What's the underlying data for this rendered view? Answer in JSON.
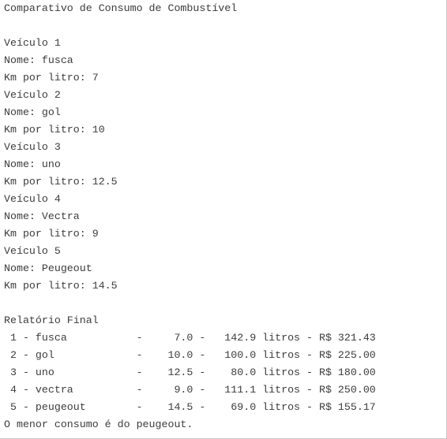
{
  "console": {
    "lines": [
      "Comparativo de Consumo de Combustível",
      "",
      "Veículo 1",
      "Nome: fusca",
      "Km por litro: 7",
      "Veículo 2",
      "Nome: gol",
      "Km por litro: 10",
      "Veículo 3",
      "Nome: uno",
      "Km por litro: 12.5",
      "Veículo 4",
      "Nome: Vectra",
      "Km por litro: 9",
      "Veículo 5",
      "Nome: Peugeout",
      "Km por litro: 14.5",
      "",
      "Relatório Final",
      " 1 - fusca           -     7.0 -   142.9 litros - R$ 321.43",
      " 2 - gol             -    10.0 -   100.0 litros - R$ 225.00",
      " 3 - uno             -    12.5 -    80.0 litros - R$ 180.00",
      " 4 - vectra          -     9.0 -   111.1 litros - R$ 250.00",
      " 5 - peugeout        -    14.5 -    69.0 litros - R$ 155.17",
      "O menor consumo é do peugeout."
    ]
  }
}
